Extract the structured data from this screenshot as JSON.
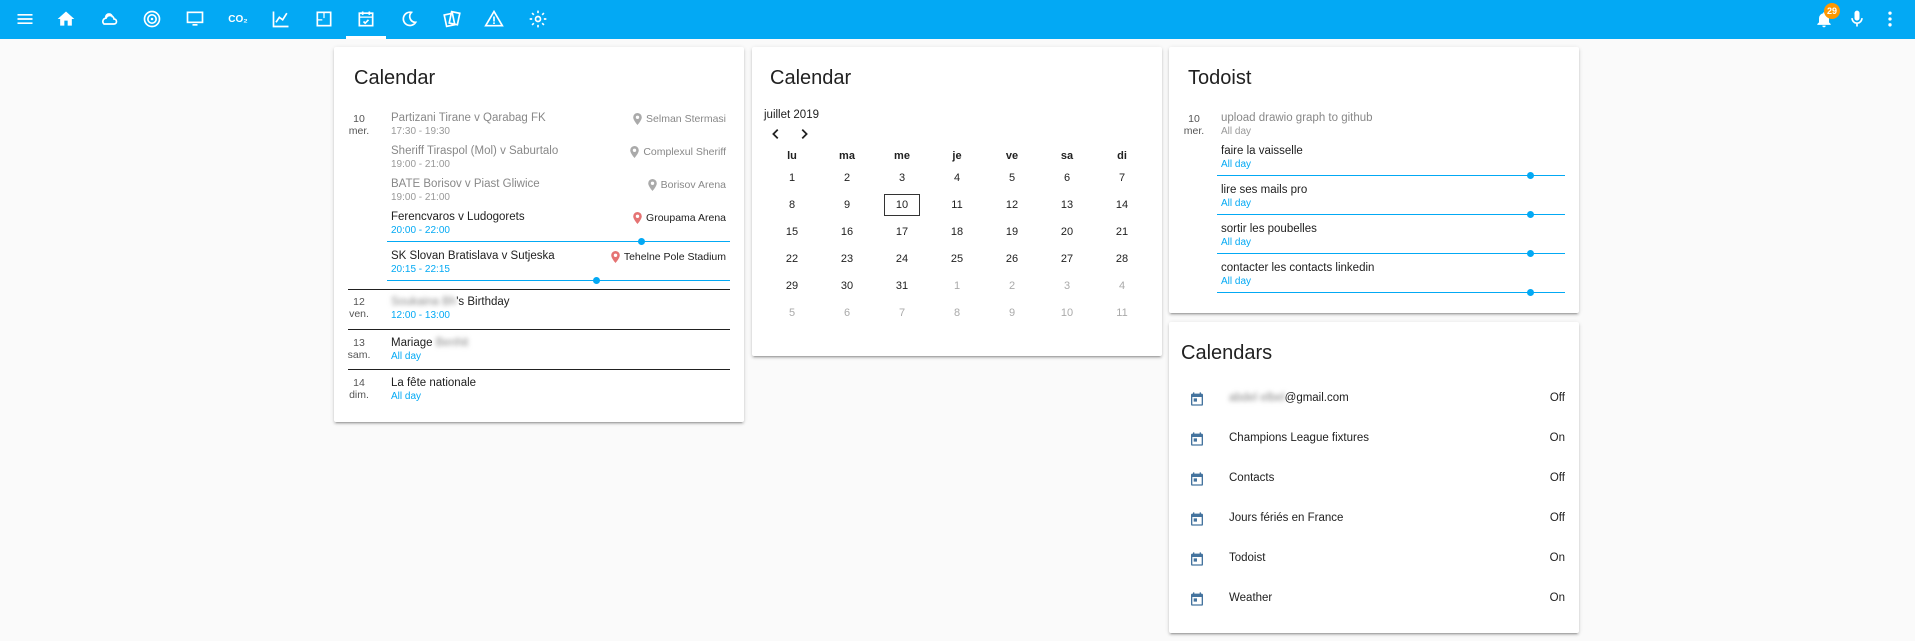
{
  "colors": {
    "accent": "#03a9f4",
    "badge": "#ff9800",
    "location_pin": "#e57373"
  },
  "topbar": {
    "icons": [
      "menu-icon",
      "home-icon",
      "weather-icon",
      "radar-icon",
      "monitor-icon",
      "co2-icon",
      "chart-line-icon",
      "floorplan-icon",
      "calendar-check-icon",
      "moon-icon",
      "cards-icon",
      "alert-icon",
      "settings-icon"
    ],
    "co2_label": "CO₂",
    "notification_count": "29"
  },
  "calendar_list": {
    "title": "Calendar",
    "days": [
      {
        "day": "10",
        "dow": "mer.",
        "events": [
          {
            "title": "Partizani Tirane v Qarabag FK",
            "time": "17:30 - 19:30",
            "location": "Selman Stermasi"
          },
          {
            "title": "Sheriff Tiraspol (Mol) v Saburtalo",
            "time": "19:00 - 21:00",
            "location": "Complexul Sheriff"
          },
          {
            "title": "BATE Borisov v Piast Gliwice",
            "time": "19:00 - 21:00",
            "location": "Borisov Arena"
          },
          {
            "title": "Ferencvaros v Ludogorets",
            "time": "20:00 - 22:00",
            "location": "Groupama Arena"
          },
          {
            "title": "SK Slovan Bratislava v Sutjeska",
            "time": "20:15 - 22:15",
            "location": "Tehelne Pole Stadium"
          }
        ]
      },
      {
        "day": "12",
        "dow": "ven.",
        "events": [
          {
            "title_blur": "Soukaina Bh",
            "title": "'s Birthday",
            "time": "12:00 - 13:00"
          }
        ]
      },
      {
        "day": "13",
        "dow": "sam.",
        "events": [
          {
            "title": "Mariage ",
            "title_blur": "Benhit",
            "time": "All day"
          }
        ]
      },
      {
        "day": "14",
        "dow": "dim.",
        "events": [
          {
            "title": "La fête nationale",
            "time": "All day"
          }
        ]
      }
    ]
  },
  "calendar_month": {
    "title": "Calendar",
    "month_label": "juillet 2019",
    "weekdays": [
      "lu",
      "ma",
      "me",
      "je",
      "ve",
      "sa",
      "di"
    ],
    "weeks": [
      [
        "1",
        "2",
        "3",
        "4",
        "5",
        "6",
        "7"
      ],
      [
        "8",
        "9",
        "10",
        "11",
        "12",
        "13",
        "14"
      ],
      [
        "15",
        "16",
        "17",
        "18",
        "19",
        "20",
        "21"
      ],
      [
        "22",
        "23",
        "24",
        "25",
        "26",
        "27",
        "28"
      ],
      [
        "29",
        "30",
        "31",
        "1",
        "2",
        "3",
        "4"
      ],
      [
        "5",
        "6",
        "7",
        "8",
        "9",
        "10",
        "11"
      ]
    ],
    "today": "10"
  },
  "todoist": {
    "title": "Todoist",
    "day": "10",
    "dow": "mer.",
    "tasks": [
      {
        "title": "upload drawio graph to github",
        "time": "All day"
      },
      {
        "title": "faire la vaisselle",
        "time": "All day"
      },
      {
        "title": "lire ses mails pro",
        "time": "All day"
      },
      {
        "title": "sortir les poubelles",
        "time": "All day"
      },
      {
        "title": "contacter les contacts linkedin",
        "time": "All day"
      }
    ]
  },
  "calendars": {
    "title": "Calendars",
    "items": [
      {
        "name_blur": "abdel elbel",
        "name": "@gmail.com",
        "state": "Off"
      },
      {
        "name": "Champions League fixtures",
        "state": "On"
      },
      {
        "name": "Contacts",
        "state": "Off"
      },
      {
        "name": "Jours fériés en France",
        "state": "Off"
      },
      {
        "name": "Todoist",
        "state": "On"
      },
      {
        "name": "Weather",
        "state": "On"
      }
    ]
  }
}
